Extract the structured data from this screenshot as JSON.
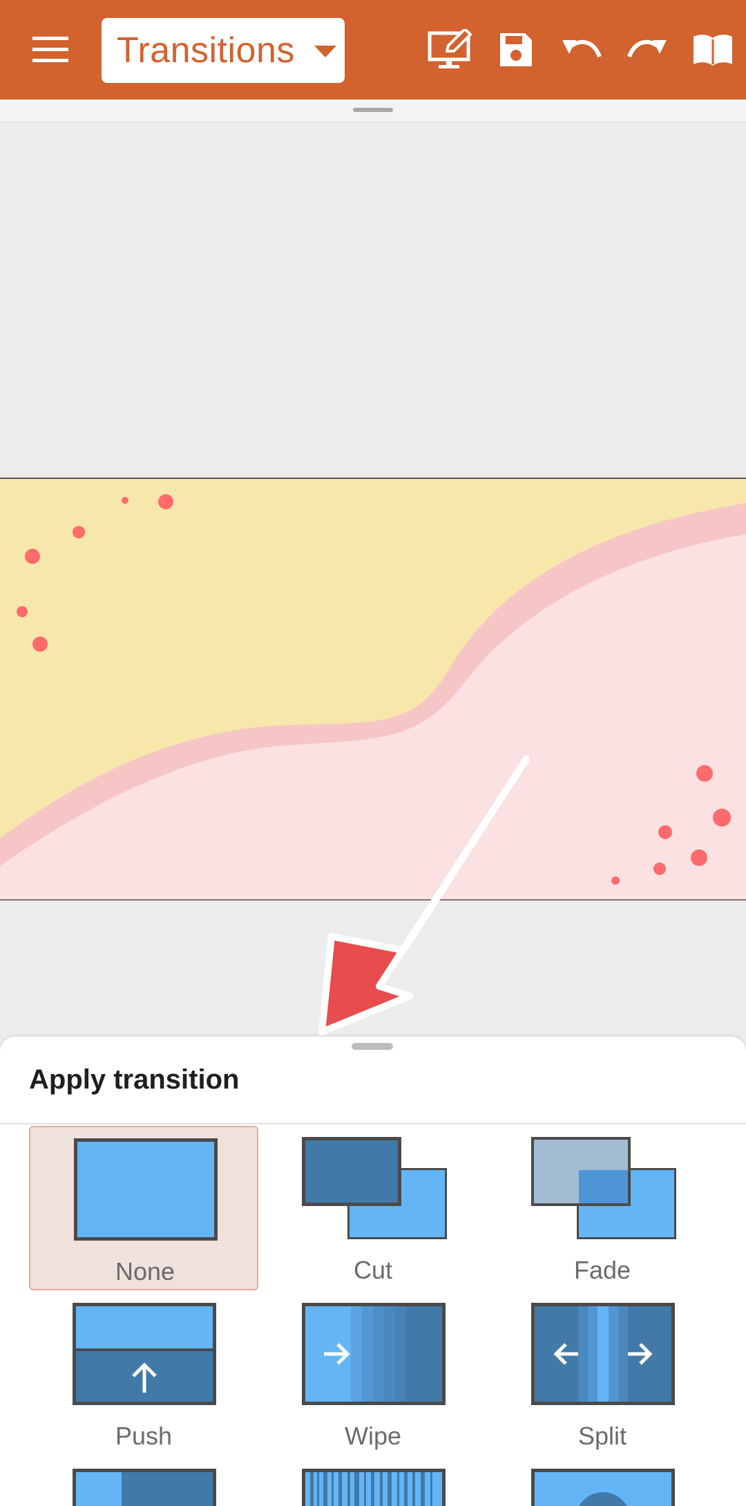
{
  "toolbar": {
    "mode_label": "Transitions",
    "icons": [
      "menu-icon",
      "chevron-down-icon",
      "present-edit-icon",
      "save-icon",
      "undo-icon",
      "redo-icon",
      "book-icon"
    ],
    "colors": {
      "bar": "#d2622e",
      "icon": "#ffffff"
    }
  },
  "slide": {
    "colors": {
      "yellow": "#f7e7ab",
      "pink_band": "#f6c6c6",
      "pink_light": "#fbe1e2",
      "dots": "#ff6b6b"
    }
  },
  "annotation": {
    "icon": "arrow-pointer-icon",
    "color": "#e84c4c"
  },
  "sheet": {
    "title": "Apply transition",
    "transitions": [
      {
        "label": "None",
        "selected": true
      },
      {
        "label": "Cut",
        "selected": false
      },
      {
        "label": "Fade",
        "selected": false
      },
      {
        "label": "Push",
        "selected": false
      },
      {
        "label": "Wipe",
        "selected": false
      },
      {
        "label": "Split",
        "selected": false
      }
    ]
  }
}
